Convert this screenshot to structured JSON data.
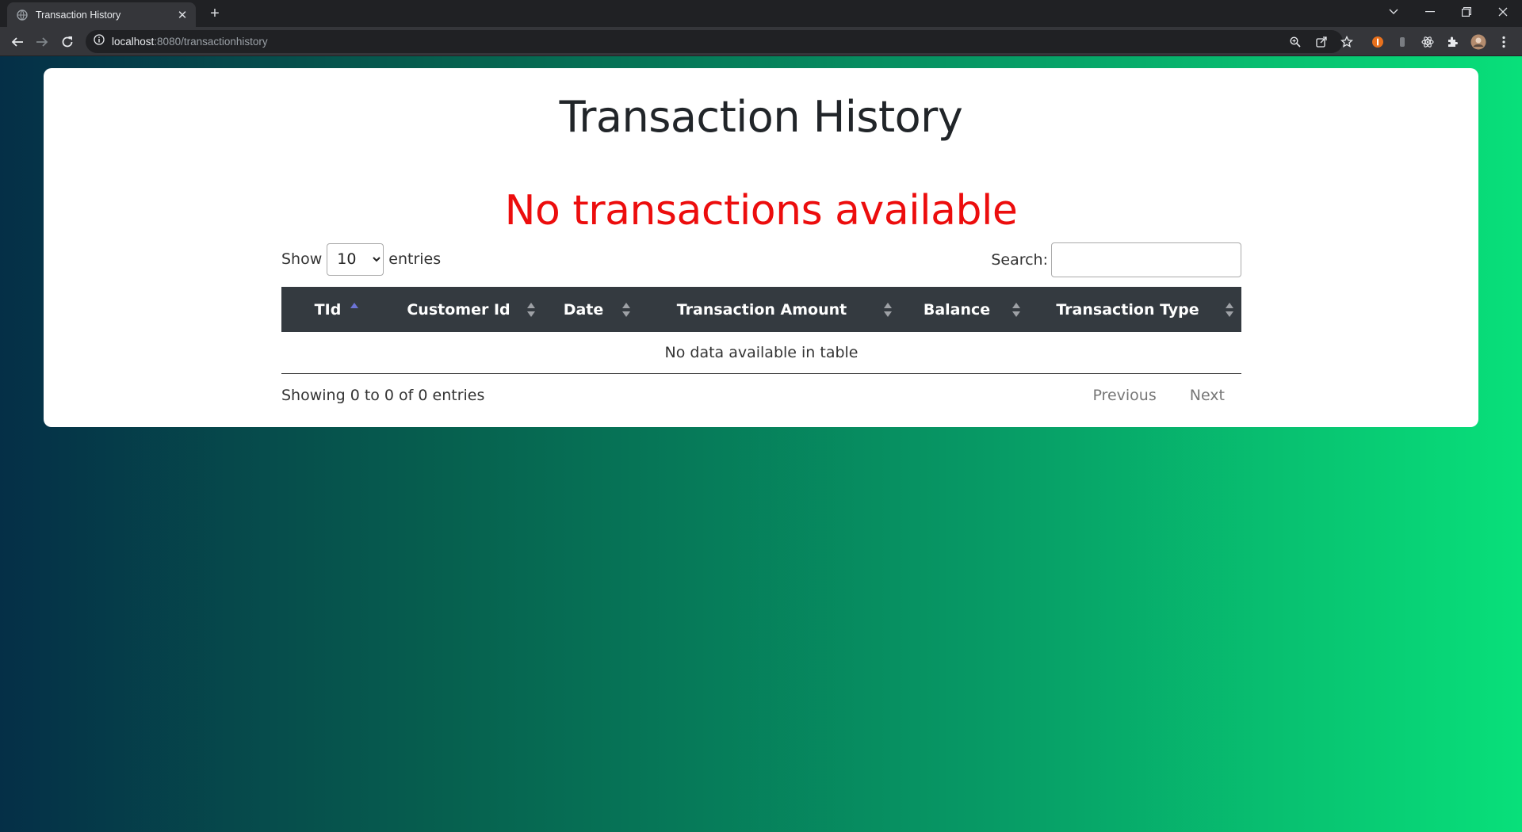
{
  "browser": {
    "tab_title": "Transaction History",
    "url_host": "localhost",
    "url_rest": ":8080/transactionhistory"
  },
  "page": {
    "title": "Transaction History",
    "empty_message": "No transactions available",
    "accent_color": "#ec0d0d",
    "background_gradient": [
      "#052f47",
      "#079a65",
      "#08e07a"
    ]
  },
  "table_controls": {
    "show_label": "Show",
    "entries_label": "entries",
    "page_length": "10",
    "search_label": "Search:",
    "search_value": ""
  },
  "table": {
    "columns": [
      "TId",
      "Customer Id",
      "Date",
      "Transaction Amount",
      "Balance",
      "Transaction Type"
    ],
    "sorted_column": "TId",
    "sort_direction": "ascending",
    "header_color": "#343a40",
    "empty_text": "No data available in table"
  },
  "footer": {
    "info": "Showing 0 to 0 of 0 entries",
    "previous_label": "Previous",
    "next_label": "Next"
  }
}
